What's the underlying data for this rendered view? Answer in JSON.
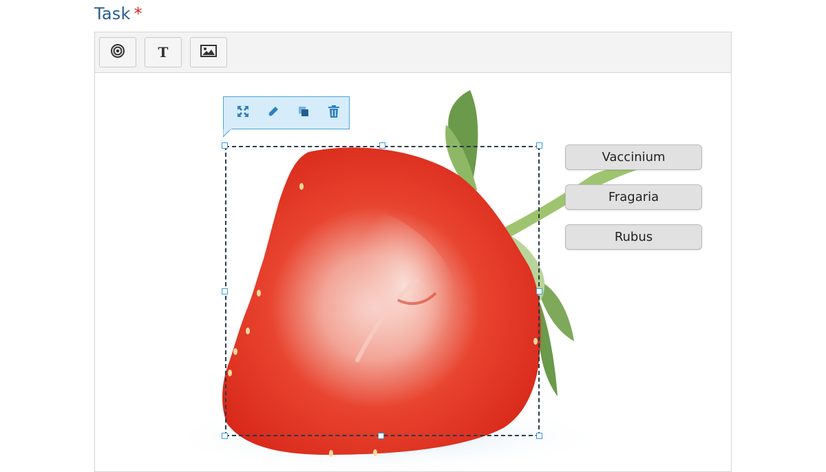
{
  "task": {
    "title": "Task",
    "required_mark": "*"
  },
  "toolbar": {
    "buttons": [
      {
        "icon": "target-icon",
        "name": "drop-zone"
      },
      {
        "icon": "text-icon",
        "glyph": "T",
        "name": "text"
      },
      {
        "icon": "image-icon",
        "name": "image"
      }
    ]
  },
  "context_toolbar": {
    "buttons": [
      "expand-icon",
      "pencil-icon",
      "layers-icon",
      "trash-icon"
    ]
  },
  "draggables": [
    {
      "label": "Vaccinium"
    },
    {
      "label": "Fragaria"
    },
    {
      "label": "Rubus"
    }
  ],
  "colors": {
    "title": "#2a5f8f",
    "required": "#d9262b",
    "accent": "#2f7fc1",
    "selection_handle": "#3a9ae0"
  }
}
